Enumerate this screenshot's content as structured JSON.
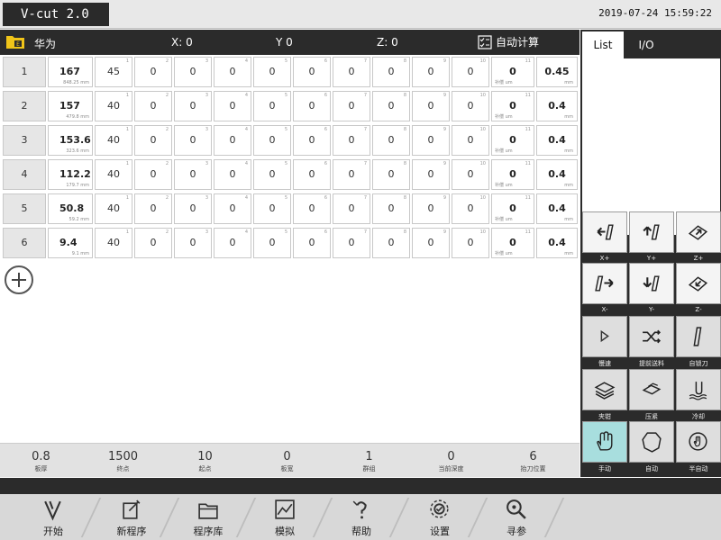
{
  "app_title": "V-cut 2.0",
  "datetime": "2019-07-24 15:59:22",
  "header": {
    "name": "华为",
    "axes": [
      {
        "label": "X:",
        "value": "0"
      },
      {
        "label": "Y",
        "value": "0"
      },
      {
        "label": "Z:",
        "value": "0"
      }
    ],
    "calc_label": "自动计算"
  },
  "table": {
    "rows": [
      {
        "index": "1",
        "length": "167",
        "sub": "848.25 mm",
        "a": "45",
        "z": [
          "0",
          "0",
          "0",
          "0",
          "0",
          "0",
          "0",
          "0",
          "0"
        ],
        "comp": "0",
        "comp_unit": "补偿 um",
        "depth": "0.45",
        "depth_unit": "mm"
      },
      {
        "index": "2",
        "length": "157",
        "sub": "479.8 mm",
        "a": "40",
        "z": [
          "0",
          "0",
          "0",
          "0",
          "0",
          "0",
          "0",
          "0",
          "0"
        ],
        "comp": "0",
        "comp_unit": "补偿 um",
        "depth": "0.4",
        "depth_unit": "mm"
      },
      {
        "index": "3",
        "length": "153.6",
        "sub": "323.6 mm",
        "a": "40",
        "z": [
          "0",
          "0",
          "0",
          "0",
          "0",
          "0",
          "0",
          "0",
          "0"
        ],
        "comp": "0",
        "comp_unit": "补偿 um",
        "depth": "0.4",
        "depth_unit": "mm"
      },
      {
        "index": "4",
        "length": "112.2",
        "sub": "179.7 mm",
        "a": "40",
        "z": [
          "0",
          "0",
          "0",
          "0",
          "0",
          "0",
          "0",
          "0",
          "0"
        ],
        "comp": "0",
        "comp_unit": "补偿 um",
        "depth": "0.4",
        "depth_unit": "mm"
      },
      {
        "index": "5",
        "length": "50.8",
        "sub": "59.2 mm",
        "a": "40",
        "z": [
          "0",
          "0",
          "0",
          "0",
          "0",
          "0",
          "0",
          "0",
          "0"
        ],
        "comp": "0",
        "comp_unit": "补偿 um",
        "depth": "0.4",
        "depth_unit": "mm"
      },
      {
        "index": "6",
        "length": "9.4",
        "sub": "9.1 mm",
        "a": "40",
        "z": [
          "0",
          "0",
          "0",
          "0",
          "0",
          "0",
          "0",
          "0",
          "0"
        ],
        "comp": "0",
        "comp_unit": "补偿 um",
        "depth": "0.4",
        "depth_unit": "mm"
      }
    ],
    "col_nums": [
      "1",
      "2",
      "3",
      "4",
      "5",
      "6",
      "7",
      "8",
      "9",
      "10",
      "11"
    ]
  },
  "status": [
    {
      "value": "0.8",
      "label": "板厚"
    },
    {
      "value": "1500",
      "label": "终点"
    },
    {
      "value": "10",
      "label": "起点"
    },
    {
      "value": "0",
      "label": "板宽"
    },
    {
      "value": "1",
      "label": "群组"
    },
    {
      "value": "0",
      "label": "当前深度"
    },
    {
      "value": "6",
      "label": "抬刀位置"
    }
  ],
  "nav": [
    {
      "label": "开始",
      "icon": "v-logo-icon"
    },
    {
      "label": "新程序",
      "icon": "new-file-icon"
    },
    {
      "label": "程序库",
      "icon": "folder-icon"
    },
    {
      "label": "模拟",
      "icon": "chart-icon"
    },
    {
      "label": "帮助",
      "icon": "help-icon"
    },
    {
      "label": "设置",
      "icon": "gear-icon"
    },
    {
      "label": "寻参",
      "icon": "search-icon"
    }
  ],
  "right_panel": {
    "tabs": [
      "List",
      "I/O"
    ],
    "keys": [
      {
        "label": "X+",
        "icon": "move-left-icon"
      },
      {
        "label": "Y+",
        "icon": "move-up-icon"
      },
      {
        "label": "Z+",
        "icon": "z-up-icon"
      },
      {
        "label": "X-",
        "icon": "move-right-icon"
      },
      {
        "label": "Y-",
        "icon": "move-down-icon"
      },
      {
        "label": "Z-",
        "icon": "z-down-icon"
      },
      {
        "label": "慢速",
        "icon": "play-icon"
      },
      {
        "label": "提前送料",
        "icon": "shuffle-icon"
      },
      {
        "label": "自锁刀",
        "icon": "blade-icon"
      },
      {
        "label": "夹钳",
        "icon": "clamp-icon"
      },
      {
        "label": "压紧",
        "icon": "press-icon"
      },
      {
        "label": "冷却",
        "icon": "coolant-icon"
      },
      {
        "label": "手动",
        "icon": "hand-icon"
      },
      {
        "label": "自动",
        "icon": "auto-icon"
      },
      {
        "label": "半自动",
        "icon": "semi-auto-icon"
      }
    ]
  },
  "colors": {
    "dark": "#2b2b2b",
    "active_key": "#a8dede",
    "folder": "#f0c419"
  }
}
